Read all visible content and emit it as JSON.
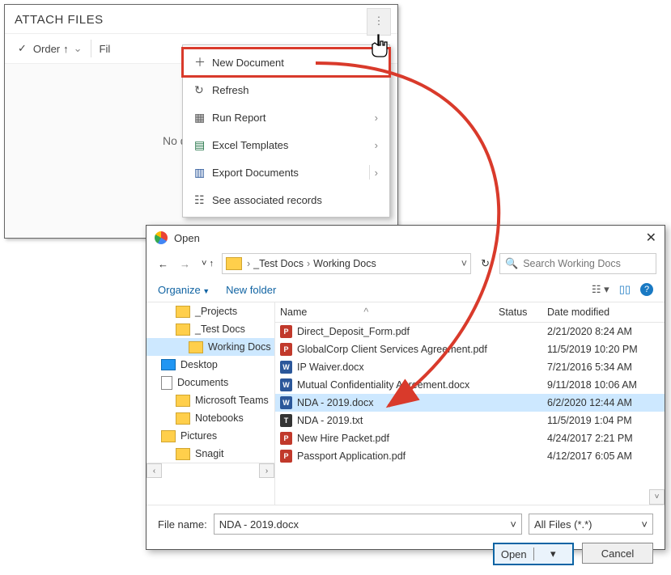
{
  "attach": {
    "title": "ATTACH FILES",
    "order_label": "Order",
    "file_filter_placeholder": "Fil",
    "nodata": "No d"
  },
  "menu": {
    "new_document": "New Document",
    "refresh": "Refresh",
    "run_report": "Run Report",
    "excel_templates": "Excel Templates",
    "export_documents": "Export Documents",
    "see_associated": "See associated records"
  },
  "dialog": {
    "title": "Open",
    "crumb_level1": "_Test Docs",
    "crumb_level2": "Working Docs",
    "search_placeholder": "Search Working Docs",
    "organize": "Organize",
    "new_folder": "New folder",
    "columns": {
      "name": "Name",
      "status": "Status",
      "date": "Date modified"
    },
    "tree": [
      {
        "label": "_Projects",
        "type": "folder",
        "indent": true
      },
      {
        "label": "_Test Docs",
        "type": "folder",
        "indent": true
      },
      {
        "label": "Working Docs",
        "type": "folder",
        "indent": true,
        "selected": true,
        "extra_indent": true
      },
      {
        "label": "Desktop",
        "type": "desktop",
        "indent": false
      },
      {
        "label": "Documents",
        "type": "doc",
        "indent": false
      },
      {
        "label": "Microsoft Teams",
        "type": "folder",
        "indent": true
      },
      {
        "label": "Notebooks",
        "type": "folder",
        "indent": true
      },
      {
        "label": "Pictures",
        "type": "pic",
        "indent": false
      },
      {
        "label": "Snagit",
        "type": "folder",
        "indent": true
      }
    ],
    "files": [
      {
        "name": "Direct_Deposit_Form.pdf",
        "type": "pdf",
        "date": "2/21/2020 8:24 AM"
      },
      {
        "name": "GlobalCorp Client Services Agreement.pdf",
        "type": "pdf",
        "date": "11/5/2019 10:20 PM"
      },
      {
        "name": "IP Waiver.docx",
        "type": "doc",
        "date": "7/21/2016 5:34 AM"
      },
      {
        "name": "Mutual Confidentiality Agreement.docx",
        "type": "doc",
        "date": "9/11/2018 10:06 AM"
      },
      {
        "name": "NDA - 2019.docx",
        "type": "doc",
        "date": "6/2/2020 12:44 AM",
        "selected": true
      },
      {
        "name": "NDA - 2019.txt",
        "type": "txt",
        "date": "11/5/2019 1:04 PM"
      },
      {
        "name": "New Hire Packet.pdf",
        "type": "pdf",
        "date": "4/24/2017 2:21 PM"
      },
      {
        "name": "Passport Application.pdf",
        "type": "pdf",
        "date": "4/12/2017 6:05 AM"
      }
    ],
    "filename_label": "File name:",
    "filename_value": "NDA - 2019.docx",
    "filter": "All Files (*.*)",
    "open_btn": "Open",
    "cancel_btn": "Cancel"
  }
}
